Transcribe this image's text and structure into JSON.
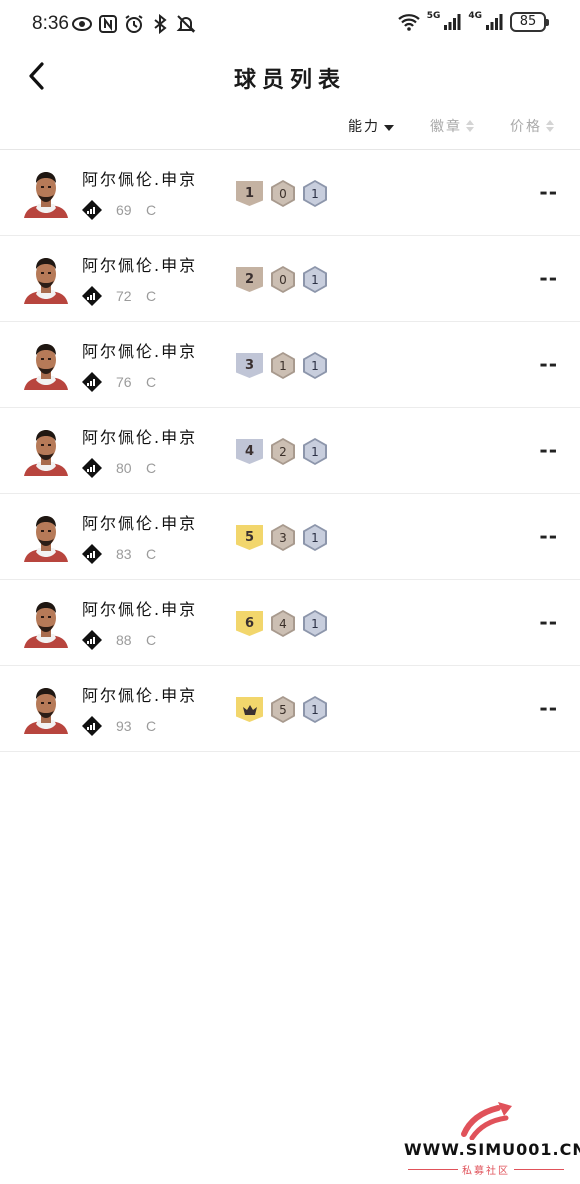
{
  "status_bar": {
    "time": "8:36",
    "network_labels": [
      "5G",
      "4G"
    ],
    "battery": "85",
    "left_icons": [
      "eye-icon",
      "nfc-icon",
      "alarm-icon",
      "bluetooth-icon",
      "mute-icon"
    ],
    "right_icons": [
      "wifi-icon",
      "signal-icon",
      "signal-icon",
      "battery-icon"
    ]
  },
  "header": {
    "title": "球员列表",
    "back_icon": "chevron-left-icon"
  },
  "sort_bar": {
    "items": [
      {
        "label": "能力",
        "active": true
      },
      {
        "label": "徽章",
        "active": false
      },
      {
        "label": "价格",
        "active": false
      }
    ]
  },
  "players": [
    {
      "name": "阿尔佩伦.申京",
      "rating": "69",
      "position": "C",
      "level": "1",
      "badge_a": "0",
      "badge_b": "1",
      "price": "--",
      "level_color": "#c4b2a2"
    },
    {
      "name": "阿尔佩伦.申京",
      "rating": "72",
      "position": "C",
      "level": "2",
      "badge_a": "0",
      "badge_b": "1",
      "price": "--",
      "level_color": "#c4b2a2"
    },
    {
      "name": "阿尔佩伦.申京",
      "rating": "76",
      "position": "C",
      "level": "3",
      "badge_a": "1",
      "badge_b": "1",
      "price": "--",
      "level_color": "#c0c5d6"
    },
    {
      "name": "阿尔佩伦.申京",
      "rating": "80",
      "position": "C",
      "level": "4",
      "badge_a": "2",
      "badge_b": "1",
      "price": "--",
      "level_color": "#c0c5d6"
    },
    {
      "name": "阿尔佩伦.申京",
      "rating": "83",
      "position": "C",
      "level": "5",
      "badge_a": "3",
      "badge_b": "1",
      "price": "--",
      "level_color": "#f2d66c"
    },
    {
      "name": "阿尔佩伦.申京",
      "rating": "88",
      "position": "C",
      "level": "6",
      "badge_a": "4",
      "badge_b": "1",
      "price": "--",
      "level_color": "#f2d66c"
    },
    {
      "name": "阿尔佩伦.申京",
      "rating": "93",
      "position": "C",
      "level": "crown",
      "badge_a": "5",
      "badge_b": "1",
      "price": "--",
      "level_color": "#f2d66c"
    }
  ],
  "watermark": {
    "url": "WWW.SIMU001.CN",
    "subtitle": "私募社区",
    "accent": "#e0525a"
  }
}
